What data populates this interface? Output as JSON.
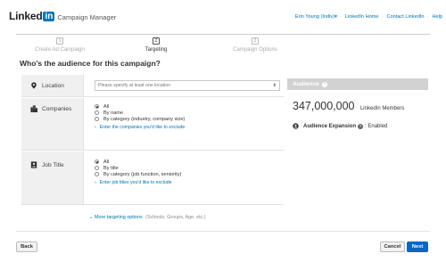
{
  "header": {
    "logo_text": "Linked",
    "logo_in": "in",
    "product": "Campaign Manager",
    "user": "Erin Young (Indiv)",
    "user_caret": "▾",
    "links": [
      "LinkedIn Home",
      "Contact LinkedIn",
      "Help"
    ]
  },
  "steps": [
    {
      "num": "1",
      "label": "Create Ad Campaign",
      "active": false
    },
    {
      "num": "2",
      "label": "Targeting",
      "active": true
    },
    {
      "num": "3",
      "label": "Campaign Options",
      "active": false
    }
  ],
  "title": "Who's the audience for this campaign?",
  "location": {
    "label": "Location",
    "icon": "map-pin-icon",
    "placeholder": "Please specify at least one location",
    "arrow": "⬍"
  },
  "companies": {
    "label": "Companies",
    "icon": "building-icon",
    "options": [
      "All",
      "By name",
      "By category (industry, company size)"
    ],
    "selected": 0,
    "exclude": "Enter the companies you'd like to exclude"
  },
  "job_title": {
    "label": "Job Title",
    "icon": "id-card-icon",
    "options": [
      "All",
      "By title",
      "By category (job function, seniority)"
    ],
    "selected": 0,
    "exclude": "Enter job titles you'd like to exclude"
  },
  "more": {
    "link": "More targeting options",
    "hint": "(Schools, Groups, Age, etc.)"
  },
  "audience": {
    "heading": "Audience",
    "count": "347,000,000",
    "unit": "LinkedIn Members",
    "expansion_label": "Audience Expansion",
    "expansion_value": ": Enabled"
  },
  "buttons": {
    "back": "Back",
    "cancel": "Cancel",
    "next": "Next"
  },
  "colors": {
    "brand": "#0077b5",
    "link": "#0073b1",
    "primary_button": "#0a66c2",
    "label_bg": "#f0f0f0",
    "audience_header": "#d2d2d2"
  }
}
